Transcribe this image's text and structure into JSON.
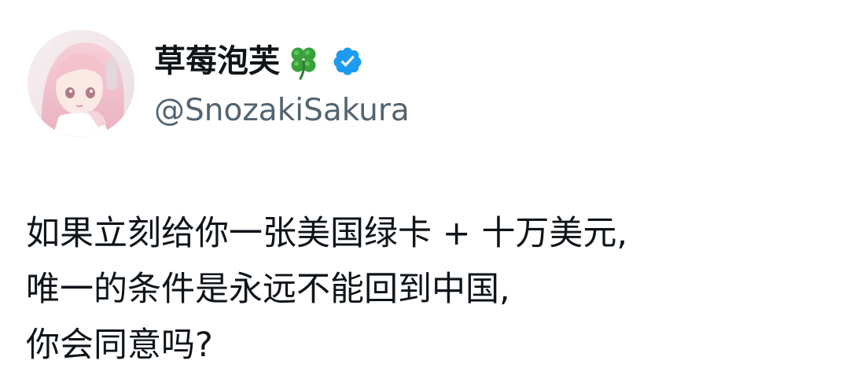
{
  "author": {
    "display_name": "草莓泡芙",
    "name_emoji": "four-leaf-clover-icon",
    "verified_badge": "verified-icon",
    "handle": "@SnozakiSakura"
  },
  "tweet": {
    "lines": [
      "如果立刻给你一张美国绿卡 + 十万美元,",
      "唯一的条件是永远不能回到中国,",
      "你会同意吗?"
    ]
  },
  "colors": {
    "verified_blue": "#1d9bf0",
    "handle_gray": "#536471",
    "text": "#0f1419",
    "clover_green": "#3aa03c"
  }
}
